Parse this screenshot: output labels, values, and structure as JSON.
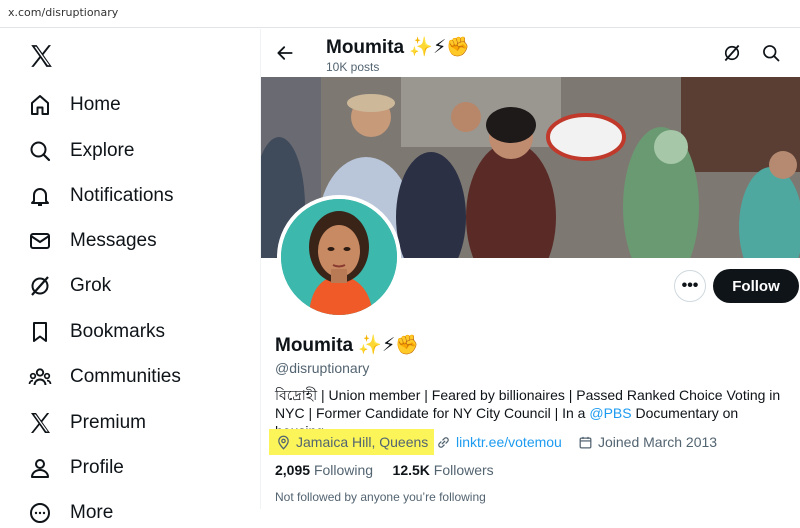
{
  "browser": {
    "url": "x.com/disruptionary"
  },
  "sidebar": {
    "items": [
      {
        "label": "Home",
        "icon": "home-icon"
      },
      {
        "label": "Explore",
        "icon": "search-icon"
      },
      {
        "label": "Notifications",
        "icon": "bell-icon"
      },
      {
        "label": "Messages",
        "icon": "envelope-icon"
      },
      {
        "label": "Grok",
        "icon": "grok-icon"
      },
      {
        "label": "Bookmarks",
        "icon": "bookmark-icon"
      },
      {
        "label": "Communities",
        "icon": "communities-icon"
      },
      {
        "label": "Premium",
        "icon": "x-logo-icon"
      },
      {
        "label": "Profile",
        "icon": "person-icon"
      },
      {
        "label": "More",
        "icon": "more-circle-icon"
      }
    ]
  },
  "header": {
    "name": "Moumita",
    "emojis": "✨⚡✊",
    "posts": "10K posts"
  },
  "profile": {
    "name": "Moumita",
    "emojis": "✨⚡✊",
    "handle": "@disruptionary",
    "bio_pre": "বিদ্রোহী | Union member | Feared by billionaires | Passed Ranked Choice Voting in NYC | Former Candidate for NY City Council | In a ",
    "bio_link": "@PBS",
    "bio_post": " Documentary on housing.",
    "location": "Jamaica Hill, Queens",
    "website": "linktr.ee/votemou",
    "joined": "Joined March 2013",
    "following_count": "2,095",
    "following_label": "Following",
    "followers_count": "12.5K",
    "followers_label": "Followers",
    "not_followed": "Not followed by anyone you’re following",
    "more_label": "•••",
    "follow_label": "Follow"
  },
  "colors": {
    "accent": "#1d9bf0",
    "highlight": "#fbf55a",
    "text": "#0f1419",
    "muted": "#536471"
  }
}
